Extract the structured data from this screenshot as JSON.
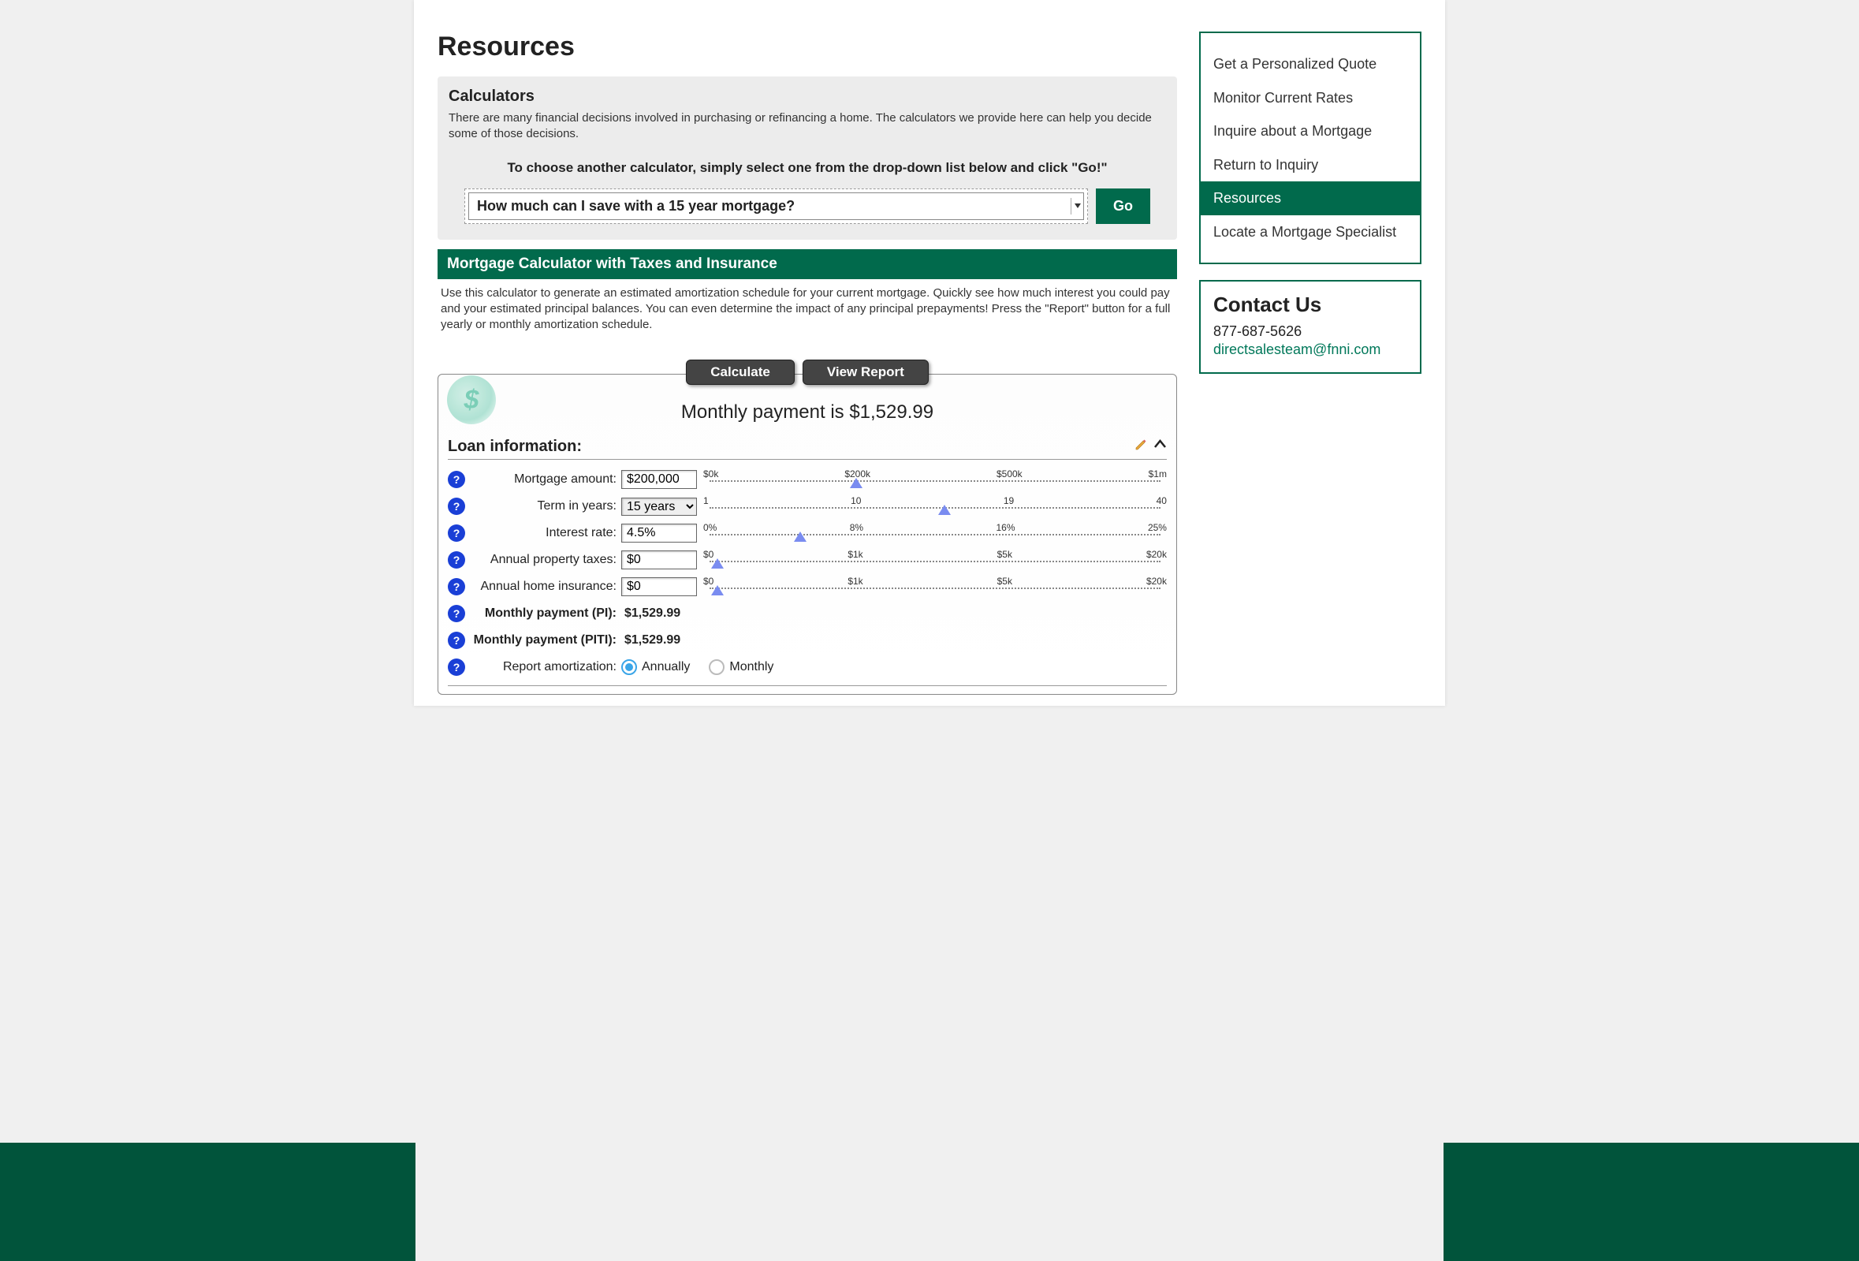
{
  "page_title": "Resources",
  "calculators": {
    "heading": "Calculators",
    "description": "There are many financial decisions involved in purchasing or refinancing a home. The calculators we provide here can help you decide some of those decisions.",
    "chooser_text": "To choose another calculator, simply select one from the drop-down list below and click \"Go!\"",
    "selected_calculator": "How much can I save with a 15 year mortgage?",
    "go_label": "Go"
  },
  "section": {
    "title": "Mortgage Calculator with Taxes and Insurance",
    "description": "Use this calculator to generate an estimated amortization schedule for your current mortgage. Quickly see how much interest you could pay and your estimated principal balances. You can even determine the impact of any principal prepayments! Press the \"Report\" button for a full yearly or monthly amortization schedule."
  },
  "calc": {
    "tab_calculate": "Calculate",
    "tab_report": "View Report",
    "result_text": "Monthly payment is $1,529.99",
    "loan_header": "Loan information:",
    "fields": {
      "mortgage_amount": {
        "label": "Mortgage amount:",
        "value": "$200,000",
        "ticks": [
          "$0k",
          "$200k",
          "$500k",
          "$1m"
        ],
        "pos": 33
      },
      "term_years": {
        "label": "Term in years:",
        "value": "15 years",
        "ticks": [
          "1",
          "10",
          "19",
          "40"
        ],
        "pos": 52
      },
      "interest_rate": {
        "label": "Interest rate:",
        "value": "4.5%",
        "ticks": [
          "0%",
          "8%",
          "16%",
          "25%"
        ],
        "pos": 21
      },
      "property_taxes": {
        "label": "Annual property taxes:",
        "value": "$0",
        "ticks": [
          "$0",
          "$1k",
          "$5k",
          "$20k"
        ],
        "pos": 3
      },
      "home_insurance": {
        "label": "Annual home insurance:",
        "value": "$0",
        "ticks": [
          "$0",
          "$1k",
          "$5k",
          "$20k"
        ],
        "pos": 3
      },
      "payment_pi": {
        "label": "Monthly payment (PI):",
        "value": "$1,529.99"
      },
      "payment_piti": {
        "label": "Monthly payment (PITI):",
        "value": "$1,529.99"
      },
      "report": {
        "label": "Report amortization:",
        "option_a": "Annually",
        "option_b": "Monthly"
      }
    }
  },
  "sidebar": {
    "items": [
      "Get a Personalized Quote",
      "Monitor Current Rates",
      "Inquire about a Mortgage",
      "Return to Inquiry",
      "Resources",
      "Locate a Mortgage Specialist"
    ],
    "active_index": 4
  },
  "contact": {
    "heading": "Contact Us",
    "phone": "877-687-5626",
    "email": "directsalesteam@fnni.com"
  }
}
